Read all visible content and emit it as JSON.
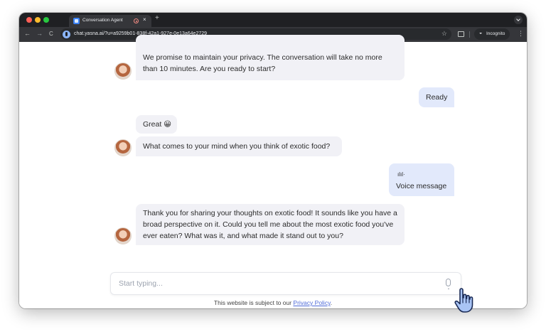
{
  "browser": {
    "tab_title": "Conversation Agent",
    "tab_close": "×",
    "new_tab": "+",
    "url": "chat.yasna.ai/?u=a9259b01-838f-42a1-927e-0e13a64e2729",
    "incognito_label": "Incognito",
    "nav_back": "←",
    "nav_forward": "→",
    "nav_reload": "C",
    "star": "☆",
    "menu": "⋮"
  },
  "chat": {
    "messages": [
      {
        "role": "bot",
        "text": "We promise to maintain your privacy. The conversation will take no more than 10 minutes. Are you ready to start?"
      },
      {
        "role": "user",
        "text": "Ready"
      },
      {
        "role": "bot",
        "text": "Great 😀"
      },
      {
        "role": "bot",
        "text": "What comes to your mind when you think of exotic food?"
      },
      {
        "role": "user",
        "type": "voice",
        "icon": "ılıl·",
        "text": "Voice message"
      },
      {
        "role": "bot",
        "text": "Thank you for sharing your thoughts on exotic food! It sounds like you have a broad perspective on it. Could you tell me about the most exotic food you've ever eaten? What was it, and what made it stand out to you?"
      }
    ]
  },
  "composer": {
    "placeholder": "Start typing..."
  },
  "footer": {
    "text": "This website is subject to our ",
    "link": "Privacy Policy",
    "end": "."
  }
}
